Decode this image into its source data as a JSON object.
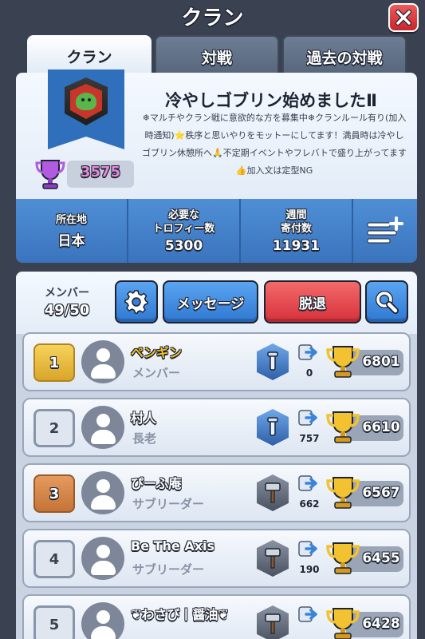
{
  "header": {
    "title": "クラン"
  },
  "tabs": [
    {
      "label": "クラン"
    },
    {
      "label": "対戦"
    },
    {
      "label": "過去の対戦"
    }
  ],
  "clan": {
    "name": "冷やしゴブリン始めましたⅡ",
    "description": "❄マルチやクラン戦に意欲的な方を募集中❄クランルール有り(加入時通知)⭐秩序と思いやりをモットーにしてます！満員時は冷やしゴブリン休憩所へ🙏不定期イベントやフレバトで盛り上がってます👍加入文は定型NG",
    "trophies": "3575",
    "stats": [
      {
        "label": "所在地",
        "value": "日本"
      },
      {
        "label": "必要な\nトロフィー数",
        "value": "5300"
      },
      {
        "label": "週間\n寄付数",
        "value": "11931"
      }
    ]
  },
  "members_panel": {
    "count_label": "メンバー",
    "count": "49/50",
    "message_button": "メッセージ",
    "leave_button": "脱退"
  },
  "members": [
    {
      "rank": "1",
      "name": "ペンギン",
      "role": "メンバー",
      "donations": "0",
      "trophies": "6801"
    },
    {
      "rank": "2",
      "name": "村人",
      "role": "長老",
      "donations": "757",
      "trophies": "6610"
    },
    {
      "rank": "3",
      "name": "ぴーふ庵",
      "role": "サブリーダー",
      "donations": "662",
      "trophies": "6567"
    },
    {
      "rank": "4",
      "name": "Be The Axis",
      "role": "サブリーダー",
      "donations": "190",
      "trophies": "6455"
    },
    {
      "rank": "5",
      "name": "❦わさび丨醤油❦",
      "role": "",
      "donations": "",
      "trophies": "6428"
    }
  ],
  "colors": {
    "background": "#3a4150",
    "accent_blue": "#3a74bd",
    "leave_red": "#d6313a",
    "gold": "#f0c22c"
  }
}
